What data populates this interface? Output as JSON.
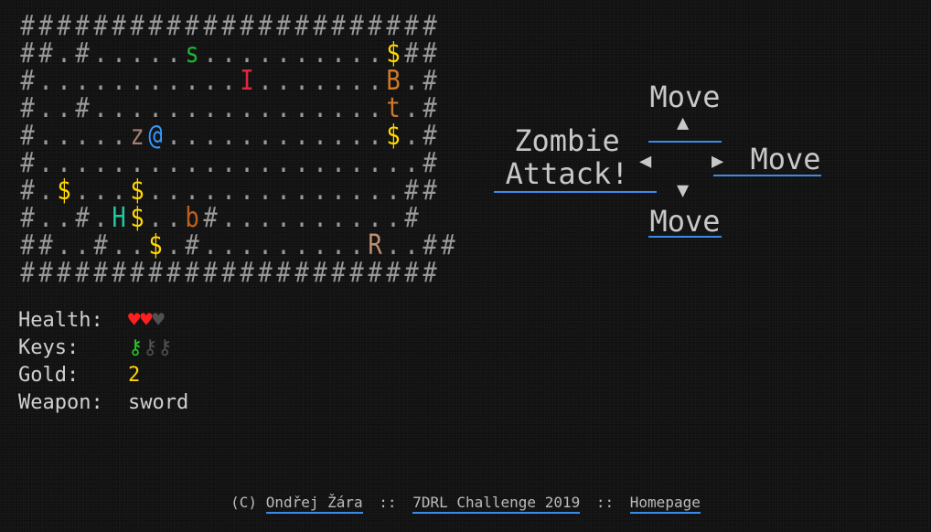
{
  "map": {
    "rows": [
      "#######################",
      "##.#.....s..........$##",
      "#...........I.......B.#",
      "#..#................t.#",
      "#.....z@............$.#",
      "#.....................#",
      "#.$...$..............##",
      "#..#.H$..b#..........#",
      "##..#..$.#.........R..##",
      "#######################"
    ],
    "colors": {
      "wall": "#9a9a9a",
      "floor": "#9a9a9a",
      "player": "#3399ff",
      "gold": "#ffd700",
      "snake": "#20b030",
      "imp": "#e0283c",
      "bat": "#d07828",
      "troll": "#d07828",
      "zombie": "#a08070",
      "hobgoblin": "#20c8a0",
      "beetle": "#c06020",
      "rat": "#c09070"
    },
    "glyph_colors": {
      "#": "wall",
      ".": "floor",
      "@": "player",
      "$": "gold",
      "s": "snake",
      "I": "imp",
      "B": "bat",
      "t": "troll",
      "z": "zombie",
      "H": "hobgoblin",
      "b": "beetle",
      "R": "rat"
    }
  },
  "status": {
    "health_label": "Health:",
    "hearts_full": "♥♥",
    "hearts_empty": "♥",
    "keys_label": "Keys:",
    "keys_have": "⚷",
    "keys_missing": "⚷⚷",
    "gold_label": "Gold:",
    "gold_value": "2",
    "weapon_label": "Weapon:",
    "weapon_value": "sword"
  },
  "controls": {
    "up_label": "Move",
    "down_label": "Move",
    "right_label": "Move",
    "left_line1": "Zombie",
    "left_line2": "Attack!",
    "arrow_up": "▲",
    "arrow_down": "▼",
    "arrow_left": "◀",
    "arrow_right": "▶"
  },
  "footer": {
    "copyright": "(C)",
    "author": "Ondřej Žára",
    "challenge": "7DRL Challenge 2019",
    "homepage": "Homepage",
    "separator": "::"
  }
}
